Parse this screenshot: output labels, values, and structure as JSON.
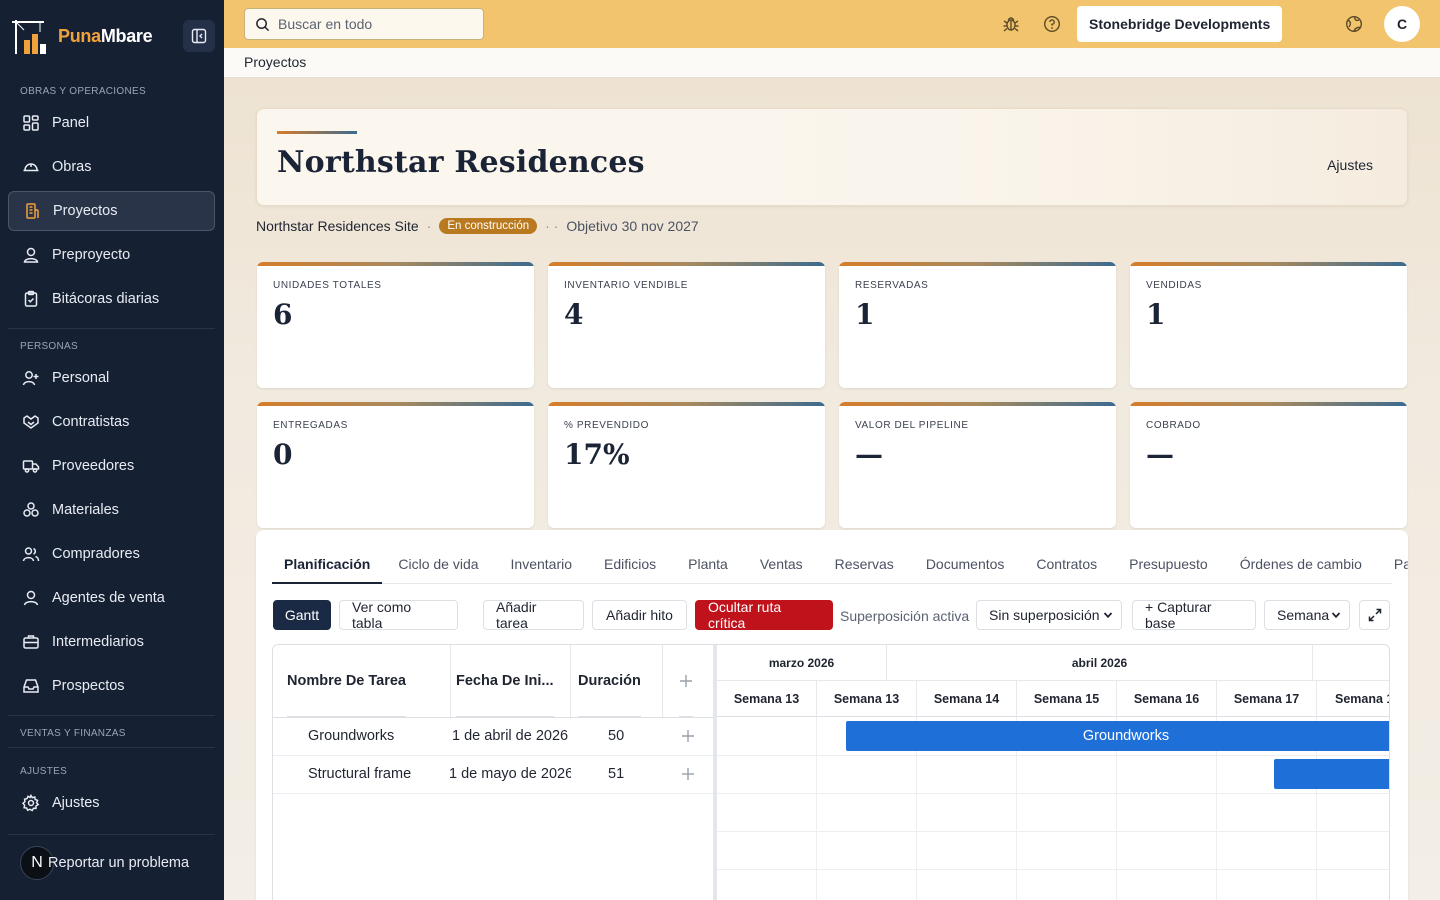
{
  "brand": {
    "name_part1": "Puna",
    "name_part2": "Mbare"
  },
  "sidebar": {
    "sections": [
      {
        "label": "OBRAS Y OPERACIONES"
      },
      {
        "label": "PERSONAS"
      },
      {
        "label": "VENTAS Y FINANZAS"
      },
      {
        "label": "AJUSTES"
      }
    ],
    "items": [
      {
        "label": "Panel",
        "icon": "dashboard-icon"
      },
      {
        "label": "Obras",
        "icon": "hardhat-icon"
      },
      {
        "label": "Proyectos",
        "icon": "building-icon",
        "active": true
      },
      {
        "label": "Preproyecto",
        "icon": "user-pin-icon"
      },
      {
        "label": "Bitácoras diarias",
        "icon": "clipboard-icon"
      },
      {
        "label": "Personal",
        "icon": "user-plus-icon"
      },
      {
        "label": "Contratistas",
        "icon": "handshake-icon"
      },
      {
        "label": "Proveedores",
        "icon": "truck-icon"
      },
      {
        "label": "Materiales",
        "icon": "boxes-icon"
      },
      {
        "label": "Compradores",
        "icon": "users-icon"
      },
      {
        "label": "Agentes de venta",
        "icon": "user-icon"
      },
      {
        "label": "Intermediarios",
        "icon": "briefcase-icon"
      },
      {
        "label": "Prospectos",
        "icon": "inbox-icon"
      },
      {
        "label": "Ajustes",
        "icon": "gear-icon"
      }
    ],
    "report": {
      "avatar_letter": "N",
      "label": "Reportar un problema"
    }
  },
  "topbar": {
    "search_placeholder": "Buscar en todo",
    "company": "Stonebridge Developments",
    "user_initial": "C"
  },
  "breadcrumb": "Proyectos",
  "project": {
    "title": "Northstar Residences",
    "settings_label": "Ajustes",
    "site": "Northstar Residences Site",
    "status": "En construcción",
    "target": "Objetivo 30 nov 2027",
    "colors": {
      "status_badge": "#b8791f",
      "accent_orange": "#d57d2a",
      "accent_blue": "#3c6a8f"
    }
  },
  "stats": [
    {
      "label": "UNIDADES TOTALES",
      "value": "6"
    },
    {
      "label": "INVENTARIO VENDIBLE",
      "value": "4"
    },
    {
      "label": "RESERVADAS",
      "value": "1"
    },
    {
      "label": "VENDIDAS",
      "value": "1"
    },
    {
      "label": "ENTREGADAS",
      "value": "0"
    },
    {
      "label": "% PREVENDIDO",
      "value": "17%"
    },
    {
      "label": "VALOR DEL PIPELINE",
      "value": "—"
    },
    {
      "label": "COBRADO",
      "value": "—"
    }
  ],
  "tabs": [
    "Planificación",
    "Ciclo de vida",
    "Inventario",
    "Edificios",
    "Planta",
    "Ventas",
    "Reservas",
    "Documentos",
    "Contratos",
    "Presupuesto",
    "Órdenes de cambio",
    "Pa"
  ],
  "toolbar": {
    "gantt": "Gantt",
    "table_view": "Ver como tabla",
    "add_task": "Añadir tarea",
    "add_milestone": "Añadir hito",
    "hide_critical": "Ocultar ruta crítica",
    "overlay_label": "Superposición activa",
    "overlay_value": "Sin superposición",
    "capture_baseline": "+ Capturar base",
    "scale_value": "Semana",
    "colors": {
      "gantt_button": "#1b2a44",
      "critical_button": "#c0121b",
      "task_bar": "#1f6fd8"
    }
  },
  "gantt": {
    "columns": [
      "Nombre De Tarea",
      "Fecha De Ini...",
      "Duración"
    ],
    "months": [
      "marzo 2026",
      "abril 2026"
    ],
    "weeks": [
      "Semana 13",
      "Semana 13",
      "Semana 14",
      "Semana 15",
      "Semana 16",
      "Semana 17",
      "Semana 1"
    ],
    "tasks": [
      {
        "name": "Groundworks",
        "start": "1 de abril de 2026",
        "duration": "50",
        "bar_label": "Groundworks"
      },
      {
        "name": "Structural frame",
        "start": "1 de mayo de 2026",
        "duration": "51",
        "bar_label": ""
      }
    ]
  }
}
